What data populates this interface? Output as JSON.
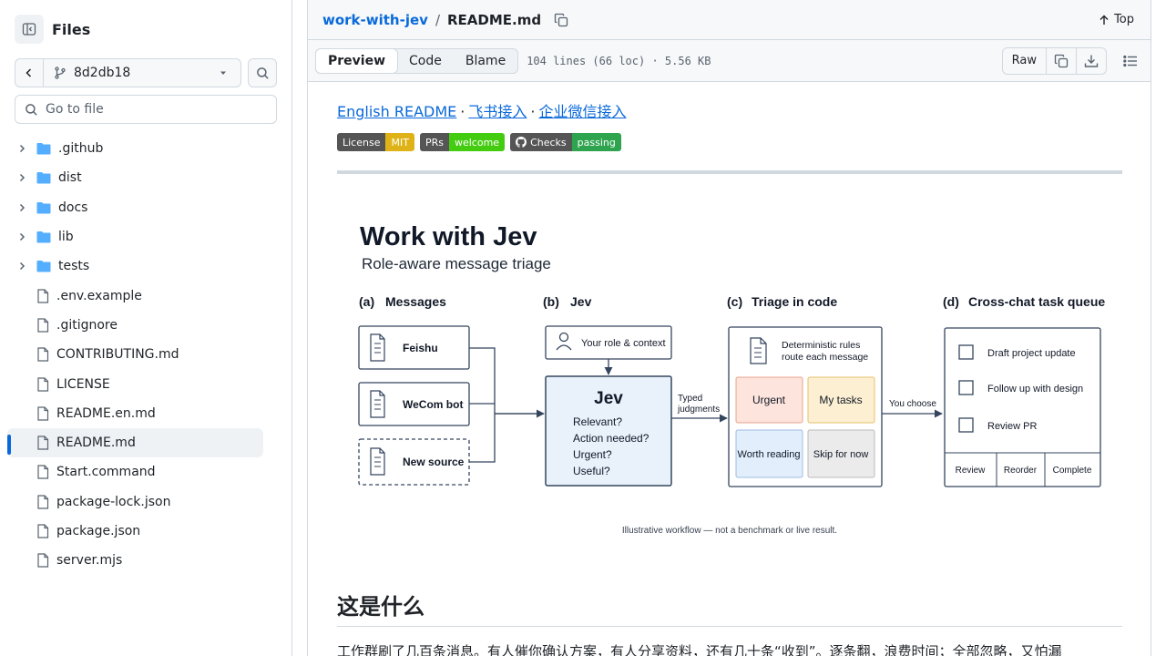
{
  "sidebar": {
    "title": "Files",
    "branch": "8d2db18",
    "go_to_file_placeholder": "Go to file",
    "items": [
      {
        "label": ".github",
        "kind": "folder"
      },
      {
        "label": "dist",
        "kind": "folder"
      },
      {
        "label": "docs",
        "kind": "folder"
      },
      {
        "label": "lib",
        "kind": "folder"
      },
      {
        "label": "tests",
        "kind": "folder"
      },
      {
        "label": ".env.example",
        "kind": "file"
      },
      {
        "label": ".gitignore",
        "kind": "file"
      },
      {
        "label": "CONTRIBUTING.md",
        "kind": "file"
      },
      {
        "label": "LICENSE",
        "kind": "file"
      },
      {
        "label": "README.en.md",
        "kind": "file"
      },
      {
        "label": "README.md",
        "kind": "file",
        "active": true
      },
      {
        "label": "Start.command",
        "kind": "file"
      },
      {
        "label": "package-lock.json",
        "kind": "file"
      },
      {
        "label": "package.json",
        "kind": "file"
      },
      {
        "label": "server.mjs",
        "kind": "file"
      }
    ]
  },
  "header": {
    "repo": "work-with-jev",
    "separator": "/",
    "file": "README.md",
    "top_label": "Top"
  },
  "filebar": {
    "tabs": [
      "Preview",
      "Code",
      "Blame"
    ],
    "active_tab": "Preview",
    "info": "104 lines (66 loc) · 5.56 KB",
    "raw_label": "Raw"
  },
  "readme": {
    "links": [
      "English README",
      "飞书接入",
      "企业微信接入"
    ],
    "link_separator": "·",
    "badges": [
      {
        "label": "License",
        "value": "MIT",
        "color": "#dfb317"
      },
      {
        "label": "PRs",
        "value": "welcome",
        "color": "#4c1"
      },
      {
        "label": "Checks",
        "value": "passing",
        "color": "#2ea44f"
      }
    ],
    "heading": "这是什么",
    "paragraph": "工作群刷了几百条消息。有人催你确认方案，有人分享资料，还有几十条“收到”。逐条翻，浪费时间；全部忽略，又怕漏"
  },
  "figure": {
    "title": "Work with Jev",
    "subtitle": "Role-aware message triage",
    "sections": {
      "a": {
        "tag": "(a)",
        "title": "Messages",
        "items": [
          "Feishu",
          "WeCom bot",
          "New source"
        ]
      },
      "b": {
        "tag": "(b)",
        "title": "Jev",
        "context": "Your role & context",
        "box_title": "Jev",
        "questions": [
          "Relevant?",
          "Action needed?",
          "Urgent?",
          "Useful?"
        ]
      },
      "c": {
        "tag": "(c)",
        "title": "Triage in code",
        "rules_line1": "Deterministic rules",
        "rules_line2": "route each message",
        "cells": [
          "Urgent",
          "My tasks",
          "Worth reading",
          "Skip for now"
        ]
      },
      "d": {
        "tag": "(d)",
        "title": "Cross-chat task queue",
        "tasks": [
          "Draft project update",
          "Follow up with design",
          "Review PR"
        ],
        "actions": [
          "Review",
          "Reorder",
          "Complete"
        ]
      }
    },
    "arrow1_line1": "Typed",
    "arrow1_line2": "judgments",
    "arrow2": "You choose",
    "footnote": "Illustrative workflow — not a benchmark or live result.",
    "colors": {
      "urgent": "#fde4dc",
      "tasks": "#fdf0d2",
      "reading": "#e2eefb",
      "skip": "#ebebeb",
      "jev": "#e9f1fb",
      "stroke": "#34455e"
    }
  }
}
